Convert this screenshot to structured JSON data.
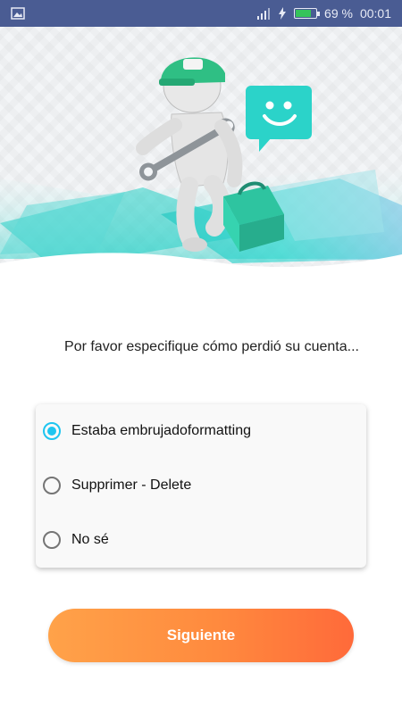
{
  "status_bar": {
    "battery_percent_text": "69 %",
    "battery_level": 0.69,
    "time": "00:01",
    "icons": [
      "image-icon",
      "signal-icon",
      "charging-icon",
      "battery-icon"
    ]
  },
  "hero": {
    "illustration": "repairman-with-wrench-and-toolbox",
    "bubble_icon": "smiley-chat-bubble-icon",
    "accent_color": "#2bd3c9"
  },
  "question": "Por favor especifique cómo perdió su cuenta...",
  "options": [
    {
      "label": "Estaba embrujadoformatting",
      "checked": true
    },
    {
      "label": " Supprimer - Delete",
      "checked": false
    },
    {
      "label": "No sé",
      "checked": false
    }
  ],
  "button": {
    "label": "Siguiente",
    "color_start": "#ffa249",
    "color_end": "#ff6a3a"
  },
  "colors": {
    "status_bar": "#4a5c93",
    "radio_selected": "#1ec5f0"
  }
}
